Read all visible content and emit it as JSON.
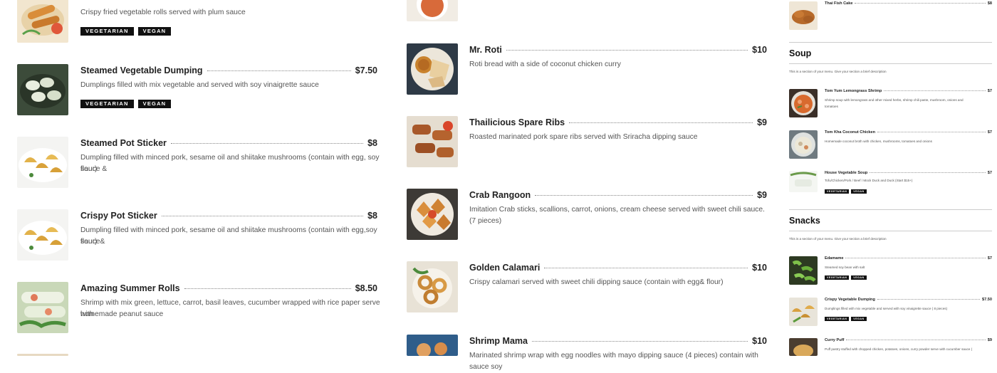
{
  "colA": {
    "items": [
      {
        "name": "",
        "price": "",
        "desc": "Crispy fried vegetable rolls served with plum sauce",
        "tags": [
          "VEGETARIAN",
          "VEGAN"
        ]
      },
      {
        "name": "Steamed Vegetable Dumping",
        "price": "$7.50",
        "desc": "Dumplings filled with mix vegetable and served with soy vinaigrette sauce",
        "tags": [
          "VEGETARIAN",
          "VEGAN"
        ]
      },
      {
        "name": "Steamed Pot Sticker",
        "price": "$8",
        "desc": "Dumpling filled with minced pork, sesame oil and shiitake mushrooms (contain with egg, soy sauce &",
        "desc2": "flour)",
        "tags": []
      },
      {
        "name": "Crispy Pot Sticker",
        "price": "$8",
        "desc": "Dumpling filled with minced pork, sesame oil and shiitake mushrooms (contain with egg,soy sauce&",
        "desc2": "flour)",
        "tags": []
      },
      {
        "name": "Amazing Summer Rolls",
        "price": "$8.50",
        "desc": "Shrimp with mix green, lettuce, carrot, basil leaves, cucumber wrapped with rice paper serve with",
        "desc2": "homemade peanut sauce",
        "tags": []
      }
    ]
  },
  "colB": {
    "items": [
      {
        "name": "Mr. Roti",
        "price": "$10",
        "desc": "Roti bread with a side of coconut chicken curry"
      },
      {
        "name": "Thailicious Spare Ribs",
        "price": "$9",
        "desc": "Roasted marinated pork spare ribs served with Sriracha dipping sauce"
      },
      {
        "name": "Crab Rangoon",
        "price": "$9",
        "desc": "Imitation Crab sticks, scallions, carrot, onions, cream cheese served with sweet chili sauce. (7 pieces)"
      },
      {
        "name": "Golden Calamari",
        "price": "$10",
        "desc": "Crispy calamari served with sweet chili dipping sauce (contain with egg& flour)"
      },
      {
        "name": "Shrimp Mama",
        "price": "$10",
        "desc": "Marinated shrimp wrap with egg noodles with mayo dipping sauce (4 pieces) contain with sauce soy"
      }
    ]
  },
  "colC": {
    "top_item": {
      "name": "Thai Fish Cake",
      "price": "$8"
    },
    "soup": {
      "title": "Soup",
      "desc": "This is a section of your menu. Give your section a brief description",
      "items": [
        {
          "name": "Tom Yum Lemongrass Shrimp",
          "price": "$7",
          "desc": "Shrimp soup with lemongrass and other mixed herbs, shrimp chili paste, mushroom, onions and",
          "desc2": "tomatoes",
          "tags": []
        },
        {
          "name": "Tom Kha Coconut Chicken",
          "price": "$7",
          "desc": "Homemade coconut broth with chicken, mushrooms, tomatoes and onions",
          "tags": []
        },
        {
          "name": "House Vegetable Soup",
          "price": "$7",
          "desc": "Tofu/Chicken/Pork / Beef / Mock Duck and Duck (Start $15+)",
          "tags": [
            "VEGETARIAN",
            "VEGAN"
          ]
        }
      ]
    },
    "snacks": {
      "title": "Snacks",
      "desc": "This is a section of your menu. Give your section a brief description",
      "items": [
        {
          "name": "Edamame",
          "price": "$7",
          "desc": "Steamed soy bean with salt",
          "tags": [
            "VEGETARIAN",
            "VEGAN"
          ]
        },
        {
          "name": "Crispy Vegetable Dumping",
          "price": "$7.50",
          "desc": "Dumplings filled with mix vegetable and served with soy vinaigrette sauce ( 8 pieces)",
          "tags": [
            "VEGETARIAN",
            "VEGAN"
          ]
        },
        {
          "name": "Curry Puff",
          "price": "$9",
          "desc": "Puff pastry stuffed with chopped chicken, potatoes, onions, curry powder serve with cucumber sauce (",
          "tags": []
        }
      ]
    }
  }
}
